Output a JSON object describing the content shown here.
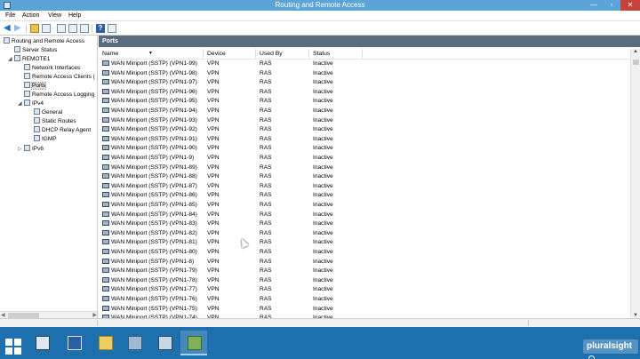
{
  "window": {
    "title": "Routing and Remote Access",
    "min": "—",
    "max": "▫",
    "close": "✕"
  },
  "menu": [
    "File",
    "Action",
    "View",
    "Help"
  ],
  "tree": {
    "items": [
      {
        "label": "Routing and Remote Access",
        "icon": "rras-icon"
      },
      {
        "label": "Server Status",
        "icon": "server-status-icon"
      },
      {
        "label": "REMOTE1",
        "icon": "server-icon",
        "expander": "◢"
      },
      {
        "label": "Network Interfaces",
        "icon": "network-interfaces-icon"
      },
      {
        "label": "Remote Access Clients (",
        "icon": "clients-icon"
      },
      {
        "label": "Ports",
        "icon": "ports-icon",
        "selected": true
      },
      {
        "label": "Remote Access Logging",
        "icon": "logging-icon"
      },
      {
        "label": "IPv4",
        "icon": "ipv4-icon",
        "expander": "◢"
      },
      {
        "label": "General",
        "icon": "general-icon"
      },
      {
        "label": "Static Routes",
        "icon": "static-routes-icon"
      },
      {
        "label": "DHCP Relay Agent",
        "icon": "dhcp-relay-icon"
      },
      {
        "label": "IGMP",
        "icon": "igmp-icon"
      },
      {
        "label": "IPv6",
        "icon": "ipv6-icon",
        "expander": "▷"
      }
    ]
  },
  "pane": {
    "title": "Ports",
    "columns": {
      "name": "Name",
      "device": "Device",
      "used_by": "Used By",
      "status": "Status"
    },
    "rows": [
      {
        "name": "WAN Miniport (SSTP) (VPN1-99)",
        "device": "VPN",
        "used_by": "RAS",
        "status": "Inactive"
      },
      {
        "name": "WAN Miniport (SSTP) (VPN1-98)",
        "device": "VPN",
        "used_by": "RAS",
        "status": "Inactive"
      },
      {
        "name": "WAN Miniport (SSTP) (VPN1-97)",
        "device": "VPN",
        "used_by": "RAS",
        "status": "Inactive"
      },
      {
        "name": "WAN Miniport (SSTP) (VPN1-96)",
        "device": "VPN",
        "used_by": "RAS",
        "status": "Inactive"
      },
      {
        "name": "WAN Miniport (SSTP) (VPN1-95)",
        "device": "VPN",
        "used_by": "RAS",
        "status": "Inactive"
      },
      {
        "name": "WAN Miniport (SSTP) (VPN1-94)",
        "device": "VPN",
        "used_by": "RAS",
        "status": "Inactive"
      },
      {
        "name": "WAN Miniport (SSTP) (VPN1-93)",
        "device": "VPN",
        "used_by": "RAS",
        "status": "Inactive"
      },
      {
        "name": "WAN Miniport (SSTP) (VPN1-92)",
        "device": "VPN",
        "used_by": "RAS",
        "status": "Inactive"
      },
      {
        "name": "WAN Miniport (SSTP) (VPN1-91)",
        "device": "VPN",
        "used_by": "RAS",
        "status": "Inactive"
      },
      {
        "name": "WAN Miniport (SSTP) (VPN1-90)",
        "device": "VPN",
        "used_by": "RAS",
        "status": "Inactive"
      },
      {
        "name": "WAN Miniport (SSTP) (VPN1-9)",
        "device": "VPN",
        "used_by": "RAS",
        "status": "Inactive"
      },
      {
        "name": "WAN Miniport (SSTP) (VPN1-89)",
        "device": "VPN",
        "used_by": "RAS",
        "status": "Inactive"
      },
      {
        "name": "WAN Miniport (SSTP) (VPN1-88)",
        "device": "VPN",
        "used_by": "RAS",
        "status": "Inactive"
      },
      {
        "name": "WAN Miniport (SSTP) (VPN1-87)",
        "device": "VPN",
        "used_by": "RAS",
        "status": "Inactive"
      },
      {
        "name": "WAN Miniport (SSTP) (VPN1-86)",
        "device": "VPN",
        "used_by": "RAS",
        "status": "Inactive"
      },
      {
        "name": "WAN Miniport (SSTP) (VPN1-85)",
        "device": "VPN",
        "used_by": "RAS",
        "status": "Inactive"
      },
      {
        "name": "WAN Miniport (SSTP) (VPN1-84)",
        "device": "VPN",
        "used_by": "RAS",
        "status": "Inactive"
      },
      {
        "name": "WAN Miniport (SSTP) (VPN1-83)",
        "device": "VPN",
        "used_by": "RAS",
        "status": "Inactive"
      },
      {
        "name": "WAN Miniport (SSTP) (VPN1-82)",
        "device": "VPN",
        "used_by": "RAS",
        "status": "Inactive"
      },
      {
        "name": "WAN Miniport (SSTP) (VPN1-81)",
        "device": "VPN",
        "used_by": "RAS",
        "status": "Inactive"
      },
      {
        "name": "WAN Miniport (SSTP) (VPN1-80)",
        "device": "VPN",
        "used_by": "RAS",
        "status": "Inactive"
      },
      {
        "name": "WAN Miniport (SSTP) (VPN1-8)",
        "device": "VPN",
        "used_by": "RAS",
        "status": "Inactive"
      },
      {
        "name": "WAN Miniport (SSTP) (VPN1-79)",
        "device": "VPN",
        "used_by": "RAS",
        "status": "Inactive"
      },
      {
        "name": "WAN Miniport (SSTP) (VPN1-78)",
        "device": "VPN",
        "used_by": "RAS",
        "status": "Inactive"
      },
      {
        "name": "WAN Miniport (SSTP) (VPN1-77)",
        "device": "VPN",
        "used_by": "RAS",
        "status": "Inactive"
      },
      {
        "name": "WAN Miniport (SSTP) (VPN1-76)",
        "device": "VPN",
        "used_by": "RAS",
        "status": "Inactive"
      },
      {
        "name": "WAN Miniport (SSTP) (VPN1-75)",
        "device": "VPN",
        "used_by": "RAS",
        "status": "Inactive"
      },
      {
        "name": "WAN Miniport (SSTP) (VPN1-74)",
        "device": "VPN",
        "used_by": "RAS",
        "status": "Inactive"
      }
    ]
  },
  "taskbar": {
    "items": [
      "start-icon",
      "server-manager-icon",
      "powershell-icon",
      "file-explorer-icon",
      "network-app-icon",
      "rras-app-icon",
      "rras-console-icon"
    ],
    "brand": "pluralsight"
  },
  "colors": {
    "titlebar": "#5ca3d8",
    "taskbar": "#1d6fae",
    "pane_header": "#5a6d80",
    "close": "#c7423b"
  }
}
